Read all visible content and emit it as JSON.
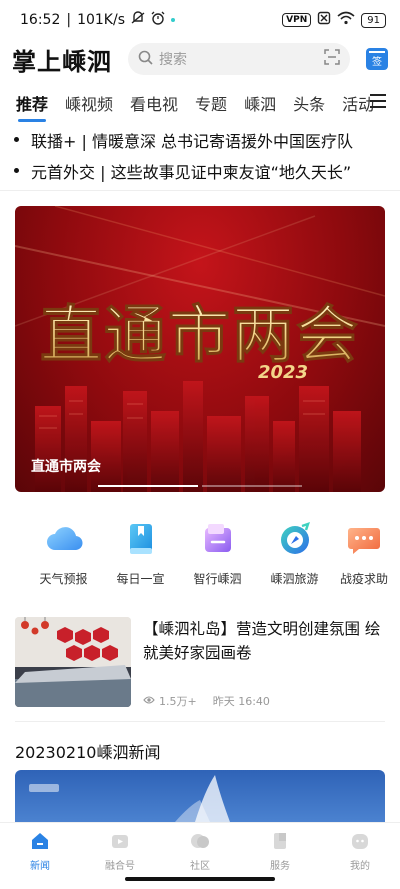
{
  "status_bar": {
    "time": "16:52",
    "speed": "101K/s",
    "vpn": "VPN",
    "battery": "91"
  },
  "header": {
    "logo": "掌上嵊泗",
    "search_placeholder": "搜索",
    "icons": [
      "search-icon",
      "scan-icon",
      "sign-in-icon"
    ],
    "sign_label": "签"
  },
  "tabs": [
    "推荐",
    "嵊视频",
    "看电视",
    "专题",
    "嵊泗",
    "头条",
    "活动"
  ],
  "active_tab": "推荐",
  "headlines": [
    "联播+ | 情暖意深 总书记寄语援外中国医疗队",
    "元首外交 | 这些故事见证中柬友谊“地久天长”"
  ],
  "banner": {
    "headline_text": "直通市两会",
    "year": "2023",
    "caption": "直通市两会"
  },
  "services": [
    {
      "label": "天气预报",
      "icon": "weather-cloud-icon"
    },
    {
      "label": "每日一宣",
      "icon": "book-icon"
    },
    {
      "label": "智行嵊泗",
      "icon": "folder-icon"
    },
    {
      "label": "嵊泗旅游",
      "icon": "compass-icon"
    },
    {
      "label": "战疫求助",
      "icon": "chat-bubble-icon"
    }
  ],
  "news": {
    "title": "【嵊泗礼岛】营造文明创建氛围 绘就美好家园画卷",
    "views": "1.5万+",
    "time": "昨天 16:40"
  },
  "section": {
    "title": "20230210嵊泗新闻"
  },
  "bottom_nav": [
    {
      "label": "新闻",
      "icon": "home-icon",
      "active": true
    },
    {
      "label": "融合号",
      "icon": "media-icon",
      "active": false
    },
    {
      "label": "社区",
      "icon": "community-icon",
      "active": false
    },
    {
      "label": "服务",
      "icon": "service-icon",
      "active": false
    },
    {
      "label": "我的",
      "icon": "profile-icon",
      "active": false
    }
  ],
  "colors": {
    "accent": "#2a82e4",
    "banner_red": "#b0121a",
    "banner_gold": "#f3d58a"
  }
}
